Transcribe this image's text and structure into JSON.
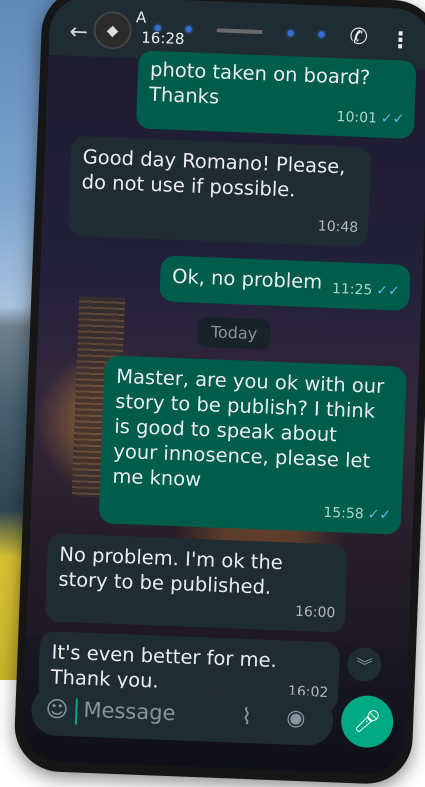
{
  "status": {
    "time": "16:28"
  },
  "header": {
    "contact_initial": "A"
  },
  "messages": [
    {
      "direction": "out",
      "text": "photo taken on board? Thanks",
      "time": "10:01",
      "ticks": "✓✓"
    },
    {
      "direction": "in",
      "text": "Good day Romano! Please, do not use if possible.",
      "time": "10:48"
    },
    {
      "direction": "out",
      "text": "Ok, no problem",
      "time": "11:25",
      "ticks": "✓✓"
    },
    {
      "direction": "out",
      "text": "Master, are you ok with our story  to be publish? I think is good to speak about your innosence, please let me know",
      "time": "15:58",
      "ticks": "✓✓"
    },
    {
      "direction": "in",
      "text": "No problem. I'm ok the story to be published.",
      "time": "16:00"
    },
    {
      "direction": "in",
      "text": "It's even better for me. Thank you.",
      "time": "16:02"
    }
  ],
  "date_separator": "Today",
  "composer": {
    "placeholder": "Message"
  },
  "icons": {
    "back": "back-arrow-icon",
    "call": "phone-call-icon",
    "menu": "more-vert-icon",
    "emoji": "emoji-icon",
    "attach": "paperclip-icon",
    "camera": "camera-icon",
    "mic": "microphone-icon",
    "scroll_down": "chevron-double-down-icon"
  },
  "colors": {
    "outgoing_bubble": "#005c4b",
    "incoming_bubble": "#202c33",
    "accent": "#00a884",
    "read_ticks": "#53bdeb"
  }
}
